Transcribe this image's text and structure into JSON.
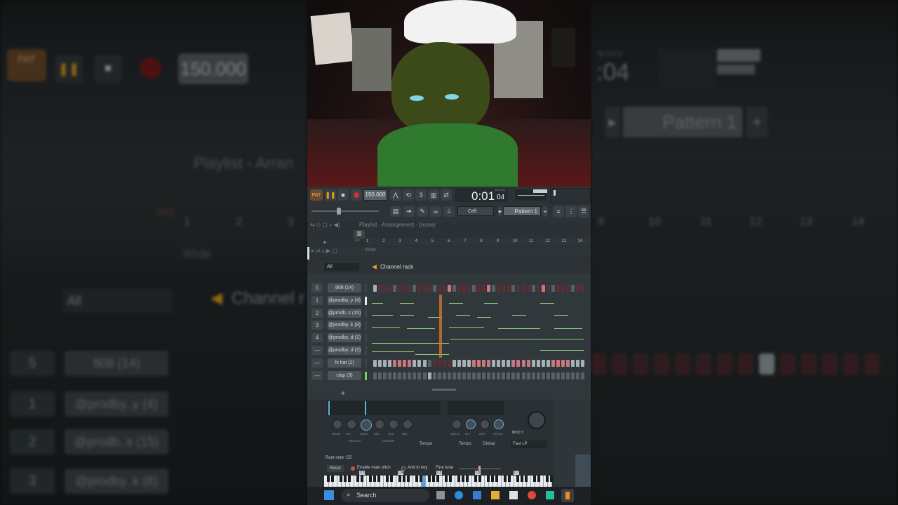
{
  "transport": {
    "pat_label": "PAT",
    "tempo": "150.000",
    "time": "0:01",
    "time_frac": "04",
    "time_unit": "M:S:CS"
  },
  "toolbar2": {
    "cell_label": "Cell",
    "pattern_label": "Pattern 1"
  },
  "playlist": {
    "breadcrumb": "Playlist · Arrangement · (none)",
    "bar_numbers": [
      "1",
      "2",
      "3",
      "4",
      "5",
      "6",
      "7",
      "8",
      "9",
      "10",
      "11",
      "12",
      "13",
      "14"
    ],
    "track_mode": "Wide",
    "pat_tag": "PAT"
  },
  "channel_rack": {
    "title": "Channel rack",
    "filter": "All",
    "channels": [
      {
        "num": "5",
        "name": "808 (14)",
        "type": "steps"
      },
      {
        "num": "1",
        "name": "@prodby..y (4)",
        "type": "notes"
      },
      {
        "num": "2",
        "name": "@prodb..s (15)",
        "type": "notes"
      },
      {
        "num": "3",
        "name": "@prodby..k (8)",
        "type": "notes"
      },
      {
        "num": "4",
        "name": "@prodby..d (1)",
        "type": "notes"
      },
      {
        "num": "---",
        "name": "@prodby..d (3)",
        "type": "notes"
      },
      {
        "num": "---",
        "name": "hi hat (2)",
        "type": "steps"
      },
      {
        "num": "---",
        "name": "clap (3)",
        "type": "steps"
      }
    ]
  },
  "instrument": {
    "env_labels_left": [
      "DELAY",
      "ATT",
      "HOLD",
      "DEC",
      "SUS",
      "REL"
    ],
    "tension": "TENSION",
    "tempo_label": "Tempo",
    "env_labels_right": [
      "DELAY",
      "ATT",
      "AMT",
      "SPEED"
    ],
    "global_label": "Global",
    "mod_label": "MOD Y",
    "filter_type": "Fast LP",
    "root_note": "Root note: C5",
    "reset": "Reset",
    "enable_pitch": "Enable main pitch",
    "add_key": "Add to key",
    "fine_tune": "Fine tune",
    "keys": [
      "C3",
      "C4",
      "C5",
      "C6",
      "C7"
    ]
  },
  "taskbar": {
    "search_placeholder": "Search"
  },
  "background": {
    "left_tempo": "150.000",
    "left_channel_title": "Channel r",
    "left_filter": "All",
    "left_playlist": "Playlist - Arran",
    "left_tags": [
      "PAT"
    ],
    "left_rows": [
      {
        "num": "5",
        "name": "808 (14)"
      },
      {
        "num": "1",
        "name": "@prodby..y (4)"
      },
      {
        "num": "2",
        "name": "@prodb..s (15)"
      },
      {
        "num": "3",
        "name": "@prodby..k (8)"
      }
    ],
    "left_ruler": [
      "1",
      "2",
      "3"
    ],
    "left_wide": "Wide",
    "right_time": ":04",
    "right_time_unit": "M:S:CS",
    "right_pattern": "Pattern 1",
    "right_ruler": [
      "9",
      "10",
      "11",
      "12",
      "13",
      "14"
    ]
  },
  "colors": {
    "step_off": "#5a2f33",
    "step_on": "#c9767e",
    "step_grey": "#55606a",
    "step_grey_on": "#a6b1b8",
    "note": "#8fd07a",
    "playhead": "#d97a2a"
  }
}
